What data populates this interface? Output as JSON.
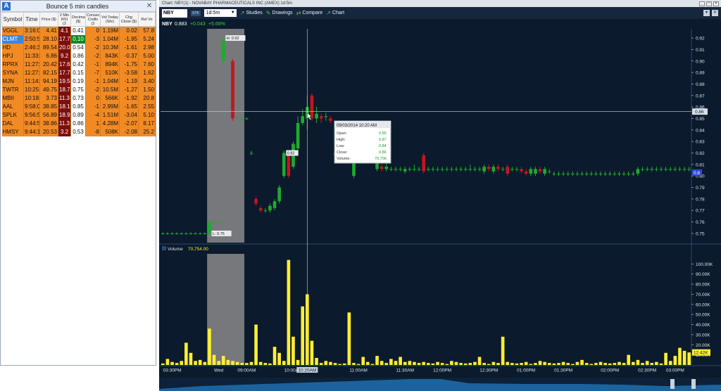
{
  "scanner": {
    "title": "Bounce 5 min candles",
    "app_badge": "A",
    "close_glyph": "✕",
    "headers": [
      "Symbol",
      "Time",
      "Price ($)",
      "2 Min RSI (2",
      "Decimal ($)",
      "Consec Cndls (2",
      "Vol Today (Shr)",
      "Chg Close ($)",
      "Rel Vo"
    ],
    "rows": [
      {
        "symbol": "VGGL",
        "time": "3:16:0",
        "price": "4.41",
        "rsi": "4.1",
        "rsi_green": false,
        "dec": "0.41",
        "consec": "0",
        "vol": "1.19M",
        "chg": "0.02",
        "rel": "57.8"
      },
      {
        "symbol": "CLMT",
        "time": "2:50:5",
        "price": "28.10",
        "rsi": "17.7",
        "rsi_green": false,
        "dec": "0.10",
        "dec_green": true,
        "consec": "-3",
        "vol": "1.04M",
        "chg": "-1.95",
        "rel": "5.24",
        "selected": true
      },
      {
        "symbol": "HD",
        "time": "2:46:3",
        "price": "89.54",
        "rsi": "20.0",
        "rsi_green": false,
        "dec": "0.54",
        "consec": "-2",
        "vol": "10.3M",
        "chg": "-1.61",
        "rel": "2.98"
      },
      {
        "symbol": "HPJ",
        "time": "11:33:",
        "price": "6.86",
        "rsi": "9.2",
        "rsi_green": false,
        "dec": "0.86",
        "consec": "-2",
        "vol": "843K",
        "chg": "-0.37",
        "rel": "5.00"
      },
      {
        "symbol": "RPRX",
        "time": "11:27:",
        "price": "20.42",
        "rsi": "17.6",
        "rsi_green": false,
        "dec": "0.42",
        "consec": "-1",
        "vol": "894K",
        "chg": "-1.75",
        "rel": "7.60"
      },
      {
        "symbol": "SYNA",
        "time": "11:27:",
        "price": "82.15",
        "rsi": "17.7",
        "rsi_green": false,
        "dec": "0.15",
        "consec": "-7",
        "vol": "510K",
        "chg": "-3.58",
        "rel": "1.62"
      },
      {
        "symbol": "MJN",
        "time": "11:14:",
        "price": "94.19",
        "rsi": "19.5",
        "rsi_green": false,
        "dec": "0.19",
        "consec": "-1",
        "vol": "1.04M",
        "chg": "-1.19",
        "rel": "3.40"
      },
      {
        "symbol": "TWTR",
        "time": "10:25:",
        "price": "49.75",
        "rsi": "18.7",
        "rsi_green": false,
        "dec": "0.75",
        "consec": "-2",
        "vol": "10.5M",
        "chg": "-1.27",
        "rel": "1.50"
      },
      {
        "symbol": "MBII",
        "time": "10:18:",
        "price": "3.73",
        "rsi": "11.3",
        "rsi_green": false,
        "dec": "0.73",
        "consec": "0",
        "vol": "566K",
        "chg": "-1.92",
        "rel": "20.8"
      },
      {
        "symbol": "AAL",
        "time": "9:58:0",
        "price": "38.85",
        "rsi": "18.1",
        "rsi_green": false,
        "dec": "0.85",
        "consec": "-1",
        "vol": "2.99M",
        "chg": "-1.65",
        "rel": "2.55"
      },
      {
        "symbol": "SPLK",
        "time": "9:56:5",
        "price": "56.89",
        "rsi": "18.9",
        "rsi_green": false,
        "dec": "0.89",
        "consec": "-4",
        "vol": "1.51M",
        "chg": "-3.04",
        "rel": "5.10"
      },
      {
        "symbol": "DAL",
        "time": "9:44:5",
        "price": "38.86",
        "rsi": "11.3",
        "rsi_green": false,
        "dec": "0.86",
        "consec": "1",
        "vol": "4.28M",
        "chg": "-2.07",
        "rel": "8.17"
      },
      {
        "symbol": "HMSY",
        "time": "9:44:1",
        "price": "20.53",
        "rsi": "3.2",
        "rsi_green": false,
        "dec": "0.53",
        "consec": "-8",
        "vol": "508K",
        "chg": "-2.08",
        "rel": "25.2"
      }
    ]
  },
  "chart_window": {
    "title": "Chart: NBY(1) - NOVABAY PHARMACEUTICALS INC (AMEX) 1d:5m",
    "win_buttons": [
      "_",
      "□",
      "✕"
    ],
    "symbol": "NBY",
    "stk_label": "STK",
    "timeframe": "1d:5m",
    "tools": [
      {
        "label": "Studies",
        "icon": "studies-icon",
        "glyph": "↗"
      },
      {
        "label": "Drawings",
        "icon": "pencil-icon",
        "glyph": "✎"
      },
      {
        "label": "Compare",
        "icon": "compare-icon",
        "glyph": "⇄"
      },
      {
        "label": "Chart",
        "icon": "chart-icon",
        "glyph": "↗"
      }
    ],
    "right_buttons": [
      "▾",
      "✕"
    ],
    "quote_symbol": "NBY",
    "quote_price": "0.883",
    "quote_change": "+0.043",
    "quote_pct": "+5.66%",
    "volume_label": "Volume",
    "volume_value": "70,754.00",
    "colors": {
      "background": "#0b1a2c",
      "up": "#1faa2f",
      "down": "#c4161c",
      "volume": "#ffee33",
      "highlight_band": "#8a8a8a"
    }
  },
  "tooltip": {
    "datetime": "09/03/2014    10:20 AM",
    "rows": [
      {
        "label": "Open:",
        "value": "0.85"
      },
      {
        "label": "High:",
        "value": "0.87"
      },
      {
        "label": "Low:",
        "value": "0.84"
      },
      {
        "label": "Close:",
        "value": "0.86"
      },
      {
        "label": "Volume:",
        "value": "70.75K"
      }
    ]
  },
  "chart_data": {
    "type": "candlestick",
    "price_ylim": [
      0.742,
      0.928
    ],
    "price_ticks": [
      "0.92",
      "0.91",
      "0.90",
      "0.89",
      "0.88",
      "0.87",
      "0.86",
      "0.85",
      "0.84",
      "0.83",
      "0.82",
      "0.81",
      "0.80",
      "0.79",
      "0.78",
      "0.77",
      "0.76",
      "0.75"
    ],
    "price_tick_values": [
      0.92,
      0.91,
      0.9,
      0.89,
      0.88,
      0.87,
      0.86,
      0.85,
      0.84,
      0.83,
      0.82,
      0.81,
      0.8,
      0.79,
      0.78,
      0.77,
      0.76,
      0.75
    ],
    "crosshair_price_label": "0.86",
    "crosshair_price": 0.856,
    "last_price_label": "0.8",
    "last_price": 0.803,
    "annotations": [
      {
        "text": "H: 0.92",
        "bar": 13,
        "price": 0.92
      },
      {
        "text": "L: 0.75",
        "bar": 10,
        "price": 0.75
      },
      {
        "text": "0.82",
        "bar": 26,
        "price": 0.82
      }
    ],
    "highlight_range_bars": [
      10,
      18
    ],
    "crosshair_bar": 31,
    "candles": [
      {
        "o": 0.75,
        "h": 0.751,
        "c": 0.75,
        "l": 0.749
      },
      {
        "o": 0.75,
        "h": 0.751,
        "c": 0.75,
        "l": 0.749
      },
      {
        "o": 0.75,
        "h": 0.751,
        "c": 0.75,
        "l": 0.749
      },
      {
        "o": 0.75,
        "h": 0.751,
        "c": 0.75,
        "l": 0.749
      },
      {
        "o": 0.75,
        "h": 0.751,
        "c": 0.75,
        "l": 0.749
      },
      {
        "o": 0.75,
        "h": 0.751,
        "c": 0.75,
        "l": 0.749
      },
      {
        "o": 0.75,
        "h": 0.751,
        "c": 0.75,
        "l": 0.749
      },
      {
        "o": 0.75,
        "h": 0.751,
        "c": 0.75,
        "l": 0.749
      },
      {
        "o": 0.75,
        "h": 0.751,
        "c": 0.75,
        "l": 0.749
      },
      {
        "o": 0.75,
        "h": 0.751,
        "c": 0.75,
        "l": 0.749
      },
      {
        "o": 0.75,
        "h": 0.762,
        "c": 0.76,
        "l": 0.749
      },
      {
        "o": 0.76,
        "h": 0.761,
        "c": 0.76,
        "l": 0.759
      },
      {
        "o": 0.76,
        "h": 0.761,
        "c": 0.76,
        "l": 0.759
      },
      {
        "o": 0.9,
        "h": 0.92,
        "c": 0.918,
        "l": 0.898
      },
      {
        "o": 0.918,
        "h": 0.919,
        "c": 0.918,
        "l": 0.917
      },
      {
        "o": 0.9,
        "h": 0.902,
        "c": 0.85,
        "l": 0.848
      },
      {
        "o": 0.85,
        "h": 0.852,
        "c": 0.85,
        "l": 0.849
      },
      {
        "o": 0.85,
        "h": 0.852,
        "c": 0.85,
        "l": 0.849
      },
      {
        "o": 0.85,
        "h": 0.851,
        "c": 0.85,
        "l": 0.849
      },
      {
        "o": 0.82,
        "h": 0.822,
        "c": 0.82,
        "l": 0.818
      },
      {
        "o": 0.78,
        "h": 0.782,
        "c": 0.776,
        "l": 0.774
      },
      {
        "o": 0.772,
        "h": 0.774,
        "c": 0.77,
        "l": 0.768
      },
      {
        "o": 0.77,
        "h": 0.772,
        "c": 0.77,
        "l": 0.768
      },
      {
        "o": 0.77,
        "h": 0.776,
        "c": 0.774,
        "l": 0.768
      },
      {
        "o": 0.772,
        "h": 0.78,
        "c": 0.778,
        "l": 0.77
      },
      {
        "o": 0.778,
        "h": 0.792,
        "c": 0.79,
        "l": 0.776
      },
      {
        "o": 0.8,
        "h": 0.822,
        "c": 0.82,
        "l": 0.798
      },
      {
        "o": 0.82,
        "h": 0.822,
        "c": 0.8,
        "l": 0.798
      },
      {
        "o": 0.808,
        "h": 0.83,
        "c": 0.828,
        "l": 0.806
      },
      {
        "o": 0.824,
        "h": 0.852,
        "c": 0.846,
        "l": 0.822
      },
      {
        "o": 0.846,
        "h": 0.858,
        "c": 0.852,
        "l": 0.844
      },
      {
        "o": 0.85,
        "h": 0.87,
        "c": 0.86,
        "l": 0.84
      },
      {
        "o": 0.87,
        "h": 0.872,
        "c": 0.85,
        "l": 0.848
      },
      {
        "o": 0.85,
        "h": 0.86,
        "c": 0.854,
        "l": 0.846
      },
      {
        "o": 0.852,
        "h": 0.854,
        "c": 0.85,
        "l": 0.846
      },
      {
        "o": 0.852,
        "h": 0.855,
        "c": 0.852,
        "l": 0.848
      },
      {
        "o": 0.85,
        "h": 0.852,
        "c": 0.848,
        "l": 0.846
      },
      {
        "o": 0.82,
        "h": 0.822,
        "c": 0.818,
        "l": 0.816
      },
      {
        "o": 0.82,
        "h": 0.822,
        "c": 0.82,
        "l": 0.818
      },
      {
        "o": 0.82,
        "h": 0.822,
        "c": 0.818,
        "l": 0.816
      },
      {
        "o": 0.82,
        "h": 0.822,
        "c": 0.818,
        "l": 0.816
      },
      {
        "o": 0.8,
        "h": 0.821,
        "c": 0.82,
        "l": 0.798
      },
      {
        "o": 0.82,
        "h": 0.822,
        "c": 0.818,
        "l": 0.816
      },
      {
        "o": 0.818,
        "h": 0.822,
        "c": 0.82,
        "l": 0.816
      },
      {
        "o": 0.82,
        "h": 0.822,
        "c": 0.818,
        "l": 0.816
      },
      {
        "o": 0.82,
        "h": 0.822,
        "c": 0.82,
        "l": 0.816
      },
      {
        "o": 0.806,
        "h": 0.82,
        "c": 0.818,
        "l": 0.804
      },
      {
        "o": 0.808,
        "h": 0.812,
        "c": 0.806,
        "l": 0.804
      },
      {
        "o": 0.806,
        "h": 0.812,
        "c": 0.808,
        "l": 0.804
      },
      {
        "o": 0.806,
        "h": 0.808,
        "c": 0.806,
        "l": 0.804
      },
      {
        "o": 0.806,
        "h": 0.808,
        "c": 0.806,
        "l": 0.804
      },
      {
        "o": 0.806,
        "h": 0.808,
        "c": 0.806,
        "l": 0.804
      },
      {
        "o": 0.804,
        "h": 0.808,
        "c": 0.806,
        "l": 0.802
      },
      {
        "o": 0.806,
        "h": 0.808,
        "c": 0.806,
        "l": 0.804
      },
      {
        "o": 0.806,
        "h": 0.81,
        "c": 0.806,
        "l": 0.804
      },
      {
        "o": 0.806,
        "h": 0.808,
        "c": 0.806,
        "l": 0.804
      },
      {
        "o": 0.818,
        "h": 0.82,
        "c": 0.804,
        "l": 0.802
      },
      {
        "o": 0.806,
        "h": 0.808,
        "c": 0.806,
        "l": 0.804
      },
      {
        "o": 0.806,
        "h": 0.808,
        "c": 0.806,
        "l": 0.804
      },
      {
        "o": 0.806,
        "h": 0.808,
        "c": 0.806,
        "l": 0.804
      },
      {
        "o": 0.806,
        "h": 0.808,
        "c": 0.806,
        "l": 0.804
      },
      {
        "o": 0.806,
        "h": 0.808,
        "c": 0.806,
        "l": 0.804
      },
      {
        "o": 0.806,
        "h": 0.808,
        "c": 0.806,
        "l": 0.804
      },
      {
        "o": 0.806,
        "h": 0.808,
        "c": 0.806,
        "l": 0.804
      },
      {
        "o": 0.806,
        "h": 0.808,
        "c": 0.806,
        "l": 0.804
      },
      {
        "o": 0.806,
        "h": 0.808,
        "c": 0.806,
        "l": 0.804
      },
      {
        "o": 0.806,
        "h": 0.81,
        "c": 0.806,
        "l": 0.804
      },
      {
        "o": 0.806,
        "h": 0.808,
        "c": 0.806,
        "l": 0.804
      },
      {
        "o": 0.806,
        "h": 0.808,
        "c": 0.806,
        "l": 0.804
      },
      {
        "o": 0.804,
        "h": 0.81,
        "c": 0.808,
        "l": 0.802
      },
      {
        "o": 0.808,
        "h": 0.81,
        "c": 0.806,
        "l": 0.804
      },
      {
        "o": 0.804,
        "h": 0.81,
        "c": 0.808,
        "l": 0.802
      },
      {
        "o": 0.808,
        "h": 0.81,
        "c": 0.806,
        "l": 0.804
      },
      {
        "o": 0.806,
        "h": 0.808,
        "c": 0.806,
        "l": 0.804
      },
      {
        "o": 0.808,
        "h": 0.81,
        "c": 0.802,
        "l": 0.8
      },
      {
        "o": 0.806,
        "h": 0.808,
        "c": 0.806,
        "l": 0.804
      },
      {
        "o": 0.806,
        "h": 0.808,
        "c": 0.806,
        "l": 0.804
      },
      {
        "o": 0.806,
        "h": 0.808,
        "c": 0.804,
        "l": 0.802
      },
      {
        "o": 0.804,
        "h": 0.806,
        "c": 0.802,
        "l": 0.8
      },
      {
        "o": 0.802,
        "h": 0.808,
        "c": 0.806,
        "l": 0.8
      },
      {
        "o": 0.802,
        "h": 0.808,
        "c": 0.806,
        "l": 0.8
      },
      {
        "o": 0.806,
        "h": 0.808,
        "c": 0.804,
        "l": 0.802
      },
      {
        "o": 0.802,
        "h": 0.808,
        "c": 0.806,
        "l": 0.8
      },
      {
        "o": 0.804,
        "h": 0.806,
        "c": 0.804,
        "l": 0.802
      },
      {
        "o": 0.802,
        "h": 0.804,
        "c": 0.802,
        "l": 0.8
      },
      {
        "o": 0.802,
        "h": 0.804,
        "c": 0.802,
        "l": 0.8
      },
      {
        "o": 0.802,
        "h": 0.804,
        "c": 0.802,
        "l": 0.8
      },
      {
        "o": 0.802,
        "h": 0.804,
        "c": 0.802,
        "l": 0.8
      },
      {
        "o": 0.802,
        "h": 0.804,
        "c": 0.802,
        "l": 0.8
      },
      {
        "o": 0.802,
        "h": 0.804,
        "c": 0.802,
        "l": 0.8
      },
      {
        "o": 0.802,
        "h": 0.804,
        "c": 0.802,
        "l": 0.8
      },
      {
        "o": 0.802,
        "h": 0.804,
        "c": 0.802,
        "l": 0.8
      },
      {
        "o": 0.802,
        "h": 0.804,
        "c": 0.802,
        "l": 0.8
      },
      {
        "o": 0.802,
        "h": 0.804,
        "c": 0.802,
        "l": 0.8
      },
      {
        "o": 0.802,
        "h": 0.804,
        "c": 0.802,
        "l": 0.8
      },
      {
        "o": 0.802,
        "h": 0.804,
        "c": 0.802,
        "l": 0.8
      },
      {
        "o": 0.802,
        "h": 0.804,
        "c": 0.802,
        "l": 0.8
      },
      {
        "o": 0.802,
        "h": 0.804,
        "c": 0.802,
        "l": 0.8
      },
      {
        "o": 0.802,
        "h": 0.804,
        "c": 0.802,
        "l": 0.8
      },
      {
        "o": 0.802,
        "h": 0.804,
        "c": 0.802,
        "l": 0.8
      },
      {
        "o": 0.802,
        "h": 0.804,
        "c": 0.802,
        "l": 0.8
      },
      {
        "o": 0.802,
        "h": 0.804,
        "c": 0.802,
        "l": 0.8
      },
      {
        "o": 0.802,
        "h": 0.808,
        "c": 0.806,
        "l": 0.8
      },
      {
        "o": 0.806,
        "h": 0.808,
        "c": 0.806,
        "l": 0.804
      },
      {
        "o": 0.806,
        "h": 0.808,
        "c": 0.806,
        "l": 0.804
      },
      {
        "o": 0.806,
        "h": 0.808,
        "c": 0.806,
        "l": 0.804
      },
      {
        "o": 0.806,
        "h": 0.808,
        "c": 0.806,
        "l": 0.804
      },
      {
        "o": 0.806,
        "h": 0.808,
        "c": 0.806,
        "l": 0.804
      },
      {
        "o": 0.806,
        "h": 0.808,
        "c": 0.806,
        "l": 0.804
      },
      {
        "o": 0.806,
        "h": 0.808,
        "c": 0.806,
        "l": 0.804
      },
      {
        "o": 0.806,
        "h": 0.808,
        "c": 0.806,
        "l": 0.804
      },
      {
        "o": 0.806,
        "h": 0.808,
        "c": 0.806,
        "l": 0.804
      },
      {
        "o": 0.806,
        "h": 0.808,
        "c": 0.806,
        "l": 0.804
      },
      {
        "o": 0.806,
        "h": 0.808,
        "c": 0.806,
        "l": 0.804
      }
    ],
    "volume_ylim": [
      0,
      110000
    ],
    "volume_ticks": [
      "100.00K",
      "90.00K",
      "80.00K",
      "70.00K",
      "60.00K",
      "50.00K",
      "40.00K",
      "30.00K",
      "20.00K",
      "10.00K"
    ],
    "volume_tick_values": [
      100000,
      90000,
      80000,
      70000,
      60000,
      50000,
      40000,
      30000,
      20000,
      10000
    ],
    "volume_last_label": "12.42K",
    "volume_last": 12420,
    "volumes": [
      1500,
      6000,
      3000,
      2000,
      4000,
      22000,
      12000,
      4000,
      5000,
      3000,
      36000,
      10000,
      4000,
      9000,
      5000,
      4000,
      3000,
      2000,
      2000,
      3000,
      40000,
      3000,
      2000,
      1500,
      18000,
      12000,
      4000,
      104000,
      28000,
      5000,
      58000,
      70000,
      24000,
      7000,
      2000,
      4000,
      3000,
      2000,
      1000,
      1500,
      52000,
      2000,
      1000,
      8000,
      3000,
      1000,
      9000,
      4000,
      2000,
      6000,
      4000,
      8000,
      3000,
      4000,
      3000,
      2000,
      3000,
      2000,
      1500,
      3000,
      2000,
      1000,
      4000,
      3000,
      2000,
      1500,
      2000,
      3000,
      8000,
      2000,
      1000,
      3000,
      2000,
      28000,
      3000,
      2000,
      1500,
      2000,
      3000,
      1000,
      2000,
      4000,
      3000,
      2000,
      1500,
      2000,
      3000,
      2000,
      1000,
      3000,
      5000,
      2000,
      1000,
      2000,
      3000,
      2000,
      1500,
      2000,
      3000,
      2000,
      10000,
      3000,
      5000,
      2000,
      4000,
      2000,
      3000,
      1500,
      12000,
      4000,
      9000,
      17000,
      14000,
      12420
    ],
    "x_labels": [
      "03:30PM",
      "Wed",
      "09:00AM",
      "10:00AM",
      "10:20AM",
      "11:00AM",
      "11:30AM",
      "12:00PM",
      "12:30PM",
      "01:00PM",
      "01:30PM",
      "02:00PM",
      "02:30PM",
      "03:00PM"
    ],
    "x_label_bars": [
      2,
      12,
      18,
      28,
      31,
      42,
      52,
      60,
      70,
      78,
      86,
      96,
      104,
      110
    ]
  }
}
